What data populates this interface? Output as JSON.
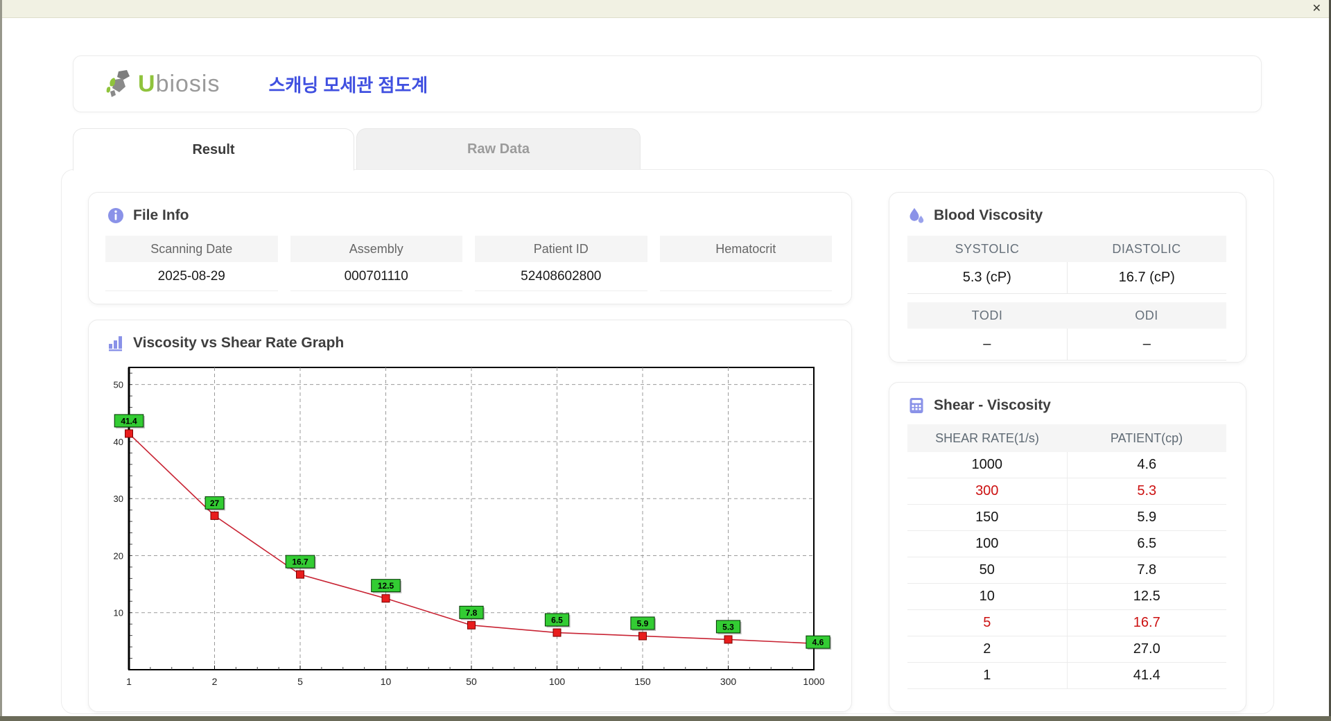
{
  "window": {
    "close_icon": "✕"
  },
  "header": {
    "logo_u": "U",
    "logo_rest": "biosis",
    "title": "스캐닝 모세관 점도계"
  },
  "tabs": {
    "result": "Result",
    "raw_data": "Raw Data"
  },
  "file_info": {
    "title": "File Info",
    "fields": [
      {
        "label": "Scanning Date",
        "value": "2025-08-29"
      },
      {
        "label": "Assembly",
        "value": "000701110"
      },
      {
        "label": "Patient ID",
        "value": "52408602800"
      },
      {
        "label": "Hematocrit",
        "value": ""
      }
    ]
  },
  "blood_viscosity": {
    "title": "Blood Viscosity",
    "sections": [
      {
        "headers": [
          "SYSTOLIC",
          "DIASTOLIC"
        ],
        "values": [
          "5.3 (cP)",
          "16.7 (cP)"
        ]
      },
      {
        "headers": [
          "TODI",
          "ODI"
        ],
        "values": [
          "–",
          "–"
        ]
      }
    ]
  },
  "graph": {
    "title": "Viscosity vs Shear Rate Graph"
  },
  "chart_data": {
    "type": "line",
    "title": "Viscosity vs Shear Rate Graph",
    "x_axis_type": "category",
    "categories": [
      "1",
      "2",
      "5",
      "10",
      "50",
      "100",
      "150",
      "300",
      "1000"
    ],
    "series": [
      {
        "name": "PATIENT(cp)",
        "values": [
          41.4,
          27,
          16.7,
          12.5,
          7.8,
          6.5,
          5.9,
          5.3,
          4.6
        ]
      }
    ],
    "point_labels": [
      "41.4",
      "27",
      "16.7",
      "12.5",
      "7.8",
      "6.5",
      "5.9",
      "5.3",
      "4.6"
    ],
    "y_ticks": [
      10,
      20,
      30,
      40,
      50
    ],
    "ylim": [
      0,
      53
    ],
    "grid": true,
    "legend": false,
    "xlabel": "",
    "ylabel": ""
  },
  "shear_table": {
    "title": "Shear - Viscosity",
    "headers": [
      "SHEAR RATE(1/s)",
      "PATIENT(cp)"
    ],
    "rows": [
      {
        "shear": "1000",
        "patient": "4.6",
        "highlight": false
      },
      {
        "shear": "300",
        "patient": "5.3",
        "highlight": true
      },
      {
        "shear": "150",
        "patient": "5.9",
        "highlight": false
      },
      {
        "shear": "100",
        "patient": "6.5",
        "highlight": false
      },
      {
        "shear": "50",
        "patient": "7.8",
        "highlight": false
      },
      {
        "shear": "10",
        "patient": "12.5",
        "highlight": false
      },
      {
        "shear": "5",
        "patient": "16.7",
        "highlight": true
      },
      {
        "shear": "2",
        "patient": "27.0",
        "highlight": false
      },
      {
        "shear": "1",
        "patient": "41.4",
        "highlight": false
      }
    ]
  },
  "colors": {
    "accent_icon": "#8a92e8",
    "title_blue": "#4050e0",
    "logo_green": "#8fc33c",
    "label_green": "#33cc33",
    "line_red": "#c82333",
    "marker_red": "#e81c1c",
    "highlight_red": "#cc1111"
  }
}
